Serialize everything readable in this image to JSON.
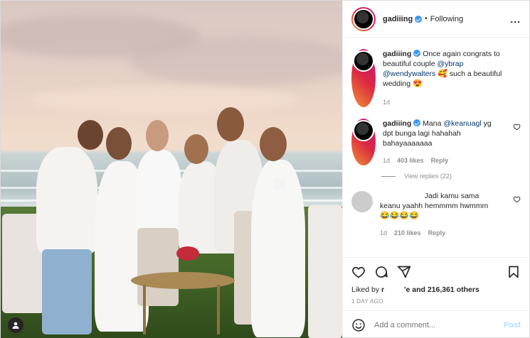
{
  "header": {
    "username": "gadiiing",
    "separator": "•",
    "follow_status": "Following",
    "more_label": "..."
  },
  "caption": {
    "username": "gadiiing",
    "text_1": "Once again congrats to beautiful couple",
    "mention_1": "@ybrap",
    "mention_2": "@wendywalters",
    "emoji_1": "🥰",
    "text_2": "such a beautiful wedding",
    "emoji_2": "😍",
    "time": "1d"
  },
  "comment_1": {
    "username": "gadiiing",
    "text_1": "Mana",
    "mention": "@keanuagl",
    "text_2": "yg dpt bunga lagi hahahah bahayaaaaaaa",
    "time": "1d",
    "likes": "403 likes",
    "reply": "Reply",
    "view_replies": "View replies (22)"
  },
  "comment_2": {
    "username_visible": "",
    "text": "Jadi kamu sama keanu yaahh hemmmm hwmmm",
    "emojis": "😂😂😂😂",
    "time": "1d",
    "likes": "210 likes",
    "reply": "Reply"
  },
  "post": {
    "liked_by_prefix": "Liked by",
    "liked_by_user": "r",
    "liked_by_mid": "'e",
    "liked_by_suffix": "and 216,361 others",
    "ago": "1 DAY AGO"
  },
  "add_comment": {
    "placeholder": "Add a comment...",
    "post_label": "Post"
  },
  "icons": {
    "like": "heart-icon",
    "comment": "comment-icon",
    "share": "share-icon",
    "save": "bookmark-icon",
    "emoji": "smiley-icon",
    "tag": "user-tag-icon"
  },
  "colors": {
    "link": "#00376b",
    "verified": "#3897f0",
    "muted": "#8e8e8e",
    "post_disabled": "#b3dbff"
  }
}
